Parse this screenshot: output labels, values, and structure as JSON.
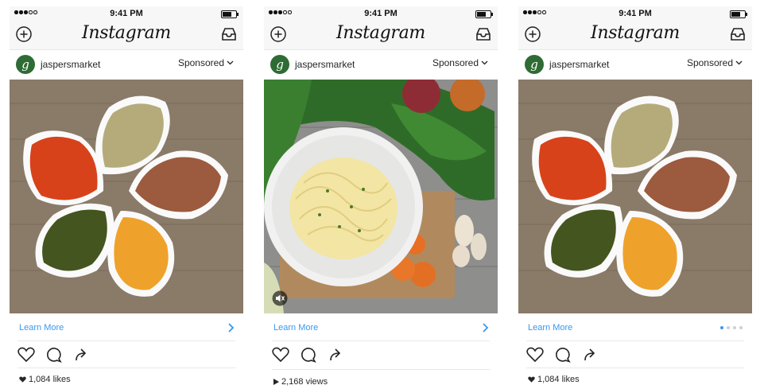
{
  "app_name": "Instagram",
  "colors": {
    "link": "#3897f0",
    "text": "#262626",
    "bar": "#f7f7f7"
  },
  "posts": [
    {
      "status": {
        "time": "9:41 PM"
      },
      "account": {
        "username": "jaspersmarket",
        "avatar_letter": "g",
        "sponsored_label": "Sponsored"
      },
      "media": {
        "subject": "spices",
        "icon": ""
      },
      "cta": {
        "label": "Learn More",
        "indicator": "chevron-right-icon"
      },
      "stats": {
        "icon": "heart-icon",
        "text": "1,084 likes"
      }
    },
    {
      "status": {
        "time": "9:41 PM"
      },
      "account": {
        "username": "jaspersmarket",
        "avatar_letter": "g",
        "sponsored_label": "Sponsored"
      },
      "media": {
        "subject": "pasta",
        "icon": "mute-icon"
      },
      "cta": {
        "label": "Learn More",
        "indicator": "chevron-right-icon"
      },
      "stats": {
        "icon": "play-icon",
        "text": "2,168 views"
      }
    },
    {
      "status": {
        "time": "9:41 PM"
      },
      "account": {
        "username": "jaspersmarket",
        "avatar_letter": "g",
        "sponsored_label": "Sponsored"
      },
      "media": {
        "subject": "spices",
        "icon": ""
      },
      "cta": {
        "label": "Learn More",
        "indicator": "carousel-dots",
        "carousel_pages": 4,
        "carousel_current": 1
      },
      "stats": {
        "icon": "heart-icon",
        "text": "1,084 likes"
      }
    }
  ]
}
